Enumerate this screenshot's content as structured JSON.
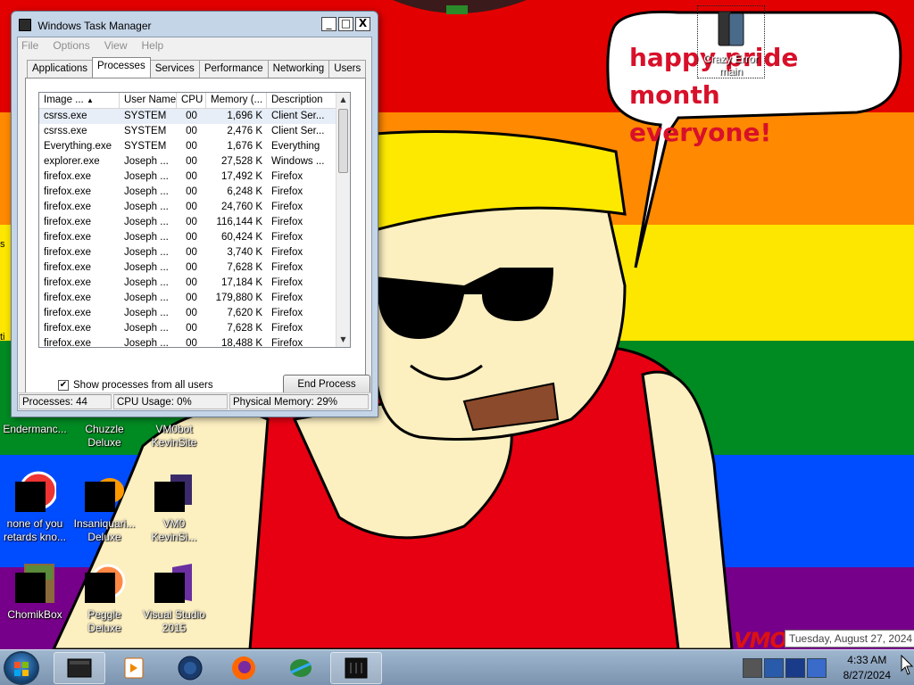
{
  "desktop": {
    "speech_bubble": {
      "line1": "happy pride month",
      "line2": "everyone!"
    },
    "watermark": "VMO",
    "selected_icon": {
      "label": "Crazy Error main"
    },
    "left_edge": [
      "s",
      "ti"
    ],
    "icons": [
      {
        "label": "Endermanc..."
      },
      {
        "label": "Chuzzle Deluxe"
      },
      {
        "label": "VM0bot KevinSite"
      },
      {
        "label": "none of you retards kno..."
      },
      {
        "label": "Insaniquari... Deluxe"
      },
      {
        "label": "VM0 KevinSi..."
      },
      {
        "label": "ChomikBox"
      },
      {
        "label": "Peggle Deluxe"
      },
      {
        "label": "Visual Studio 2015"
      }
    ]
  },
  "task_manager": {
    "title": "Windows Task Manager",
    "controls": {
      "minimize": "_",
      "maximize": "□",
      "close": "X"
    },
    "menu": [
      "File",
      "Options",
      "View",
      "Help"
    ],
    "tabs": [
      "Applications",
      "Processes",
      "Services",
      "Performance",
      "Networking",
      "Users"
    ],
    "active_tab": "Processes",
    "columns": [
      "Image ...",
      "User Name",
      "CPU",
      "Memory (...",
      "Description"
    ],
    "rows": [
      [
        "csrss.exe",
        "SYSTEM",
        "00",
        "1,696 K",
        "Client Ser..."
      ],
      [
        "csrss.exe",
        "SYSTEM",
        "00",
        "2,476 K",
        "Client Ser..."
      ],
      [
        "Everything.exe",
        "SYSTEM",
        "00",
        "1,676 K",
        "Everything"
      ],
      [
        "explorer.exe",
        "Joseph ...",
        "00",
        "27,528 K",
        "Windows ..."
      ],
      [
        "firefox.exe",
        "Joseph ...",
        "00",
        "17,492 K",
        "Firefox"
      ],
      [
        "firefox.exe",
        "Joseph ...",
        "00",
        "6,248 K",
        "Firefox"
      ],
      [
        "firefox.exe",
        "Joseph ...",
        "00",
        "24,760 K",
        "Firefox"
      ],
      [
        "firefox.exe",
        "Joseph ...",
        "00",
        "116,144 K",
        "Firefox"
      ],
      [
        "firefox.exe",
        "Joseph ...",
        "00",
        "60,424 K",
        "Firefox"
      ],
      [
        "firefox.exe",
        "Joseph ...",
        "00",
        "3,740 K",
        "Firefox"
      ],
      [
        "firefox.exe",
        "Joseph ...",
        "00",
        "7,628 K",
        "Firefox"
      ],
      [
        "firefox.exe",
        "Joseph ...",
        "00",
        "17,184 K",
        "Firefox"
      ],
      [
        "firefox.exe",
        "Joseph ...",
        "00",
        "179,880 K",
        "Firefox"
      ],
      [
        "firefox.exe",
        "Joseph ...",
        "00",
        "7,620 K",
        "Firefox"
      ],
      [
        "firefox.exe",
        "Joseph ...",
        "00",
        "7,628 K",
        "Firefox"
      ],
      [
        "firefox.exe",
        "Joseph ...",
        "00",
        "18,488 K",
        "Firefox"
      ]
    ],
    "show_all_label": "Show processes from all users",
    "show_all_checked": true,
    "end_process_label": "End Process",
    "status": {
      "processes": "Processes: 44",
      "cpu": "CPU Usage: 0%",
      "memory": "Physical Memory: 29%"
    }
  },
  "taskbar": {
    "buttons": [
      "task-manager-icon",
      "media-player-icon",
      "globe-icon",
      "firefox-icon",
      "ie-icon",
      "terminal-icon"
    ],
    "tray": [
      "cpu-meter-icon",
      "monitor-icon",
      "network-icon",
      "volume-icon"
    ],
    "clock_time": "4:33 AM",
    "clock_date": "8/27/2024",
    "date_tooltip": "Tuesday, August 27, 2024"
  },
  "colors": {
    "red": "#e30001",
    "orange": "#ff8900",
    "yellow": "#fde700",
    "green": "#008a22",
    "blue": "#004cff",
    "purple": "#760089"
  }
}
